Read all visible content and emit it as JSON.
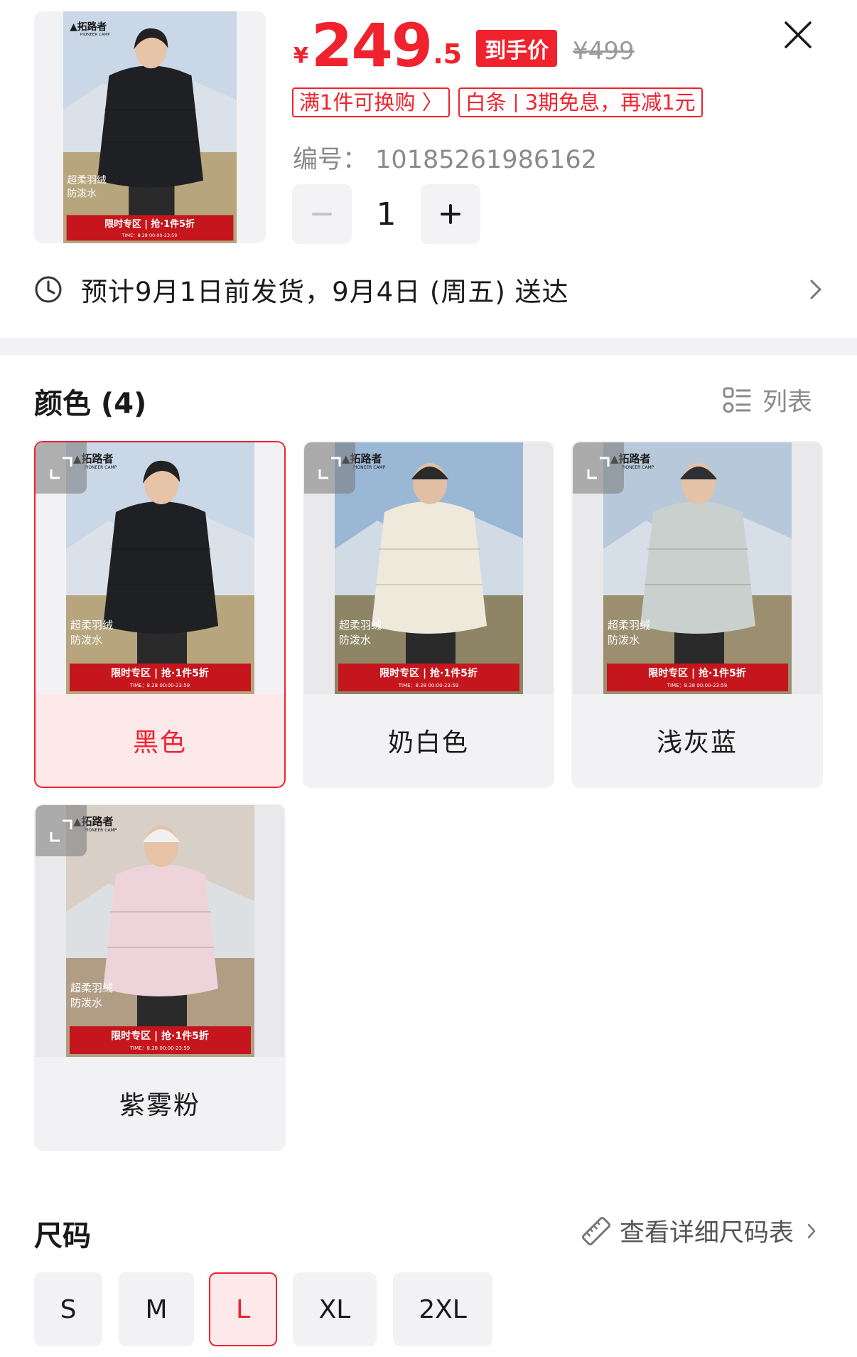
{
  "product": {
    "brand": "拓路者",
    "brand_en": "PIONEER CAMP",
    "price_currency": "¥",
    "price_integer": "249",
    "price_decimal": ".5",
    "final_price_tag": "到手价",
    "original_price": "¥499",
    "promos": [
      {
        "text": "满1件可换购 〉"
      },
      {
        "prefix": "白条",
        "text": "3期免息，再减1元"
      }
    ],
    "sku_label": "编号：",
    "sku_value": "10185261986162",
    "quantity": "1",
    "minus_label": "−",
    "plus_label": "+"
  },
  "delivery": {
    "text": "预计9月1日前发货，9月4日 (周五) 送达",
    "icon": "clock-icon"
  },
  "poster": {
    "tag1": "超柔羽绒",
    "tag2": "防泼水",
    "banner": "限时专区 | 抢·1件5折",
    "time": "TIME：8.28 00:00-23:59"
  },
  "color_section": {
    "title": "颜色 (4)",
    "list_toggle": "列表",
    "options": [
      {
        "label": "黑色",
        "selected": true,
        "jacket": "#1f2023",
        "sky": "#c9d7e6",
        "ground": "#b7a57e",
        "skin": "#e7c3a8",
        "hat": ""
      },
      {
        "label": "奶白色",
        "selected": false,
        "jacket": "#efe9dc",
        "sky": "#9ab7d6",
        "ground": "#8d8566",
        "skin": "#e0bfa3",
        "hat": "#2a2a2a"
      },
      {
        "label": "浅灰蓝",
        "selected": false,
        "jacket": "#c9d1cf",
        "sky": "#b6c8da",
        "ground": "#9c8f70",
        "skin": "#e3c2a6",
        "hat": "#2c2f33"
      },
      {
        "label": "紫雾粉",
        "selected": false,
        "jacket": "#efd3da",
        "sky": "#d8cfc7",
        "ground": "#b09d84",
        "skin": "#e6c2a7",
        "hat": "#f2f0ec"
      }
    ]
  },
  "size_section": {
    "title": "尺码",
    "chart_link": "查看详细尺码表",
    "sizes": [
      {
        "label": "S",
        "selected": false
      },
      {
        "label": "M",
        "selected": false
      },
      {
        "label": "L",
        "selected": true
      },
      {
        "label": "XL",
        "selected": false
      },
      {
        "label": "2XL",
        "selected": false
      }
    ]
  },
  "colors": {
    "accent": "#f0222d",
    "accent_bg": "#fde8ea",
    "card_bg": "#f2f2f4",
    "muted_text": "#8a8a8a"
  }
}
